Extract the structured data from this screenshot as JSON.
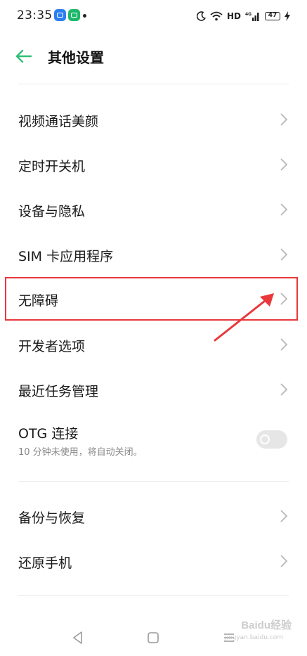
{
  "status_bar": {
    "time": "23:35",
    "network": "HD",
    "signal_label": "4G",
    "battery": "47"
  },
  "header": {
    "title": "其他设置"
  },
  "settings": {
    "items": [
      {
        "label": "视频通话美颜"
      },
      {
        "label": "定时开关机"
      },
      {
        "label": "设备与隐私"
      },
      {
        "label": "SIM 卡应用程序"
      },
      {
        "label": "无障碍"
      },
      {
        "label": "开发者选项"
      },
      {
        "label": "最近任务管理"
      }
    ],
    "otg": {
      "label": "OTG 连接",
      "description": "10 分钟未使用，将自动关闭。",
      "enabled": false
    },
    "items2": [
      {
        "label": "备份与恢复"
      },
      {
        "label": "还原手机"
      }
    ]
  },
  "watermark": {
    "brand": "Baidu经验",
    "url": "jingyan.baidu.com"
  },
  "colors": {
    "accent_back": "#2fbf78",
    "highlight": "#e8383b"
  }
}
